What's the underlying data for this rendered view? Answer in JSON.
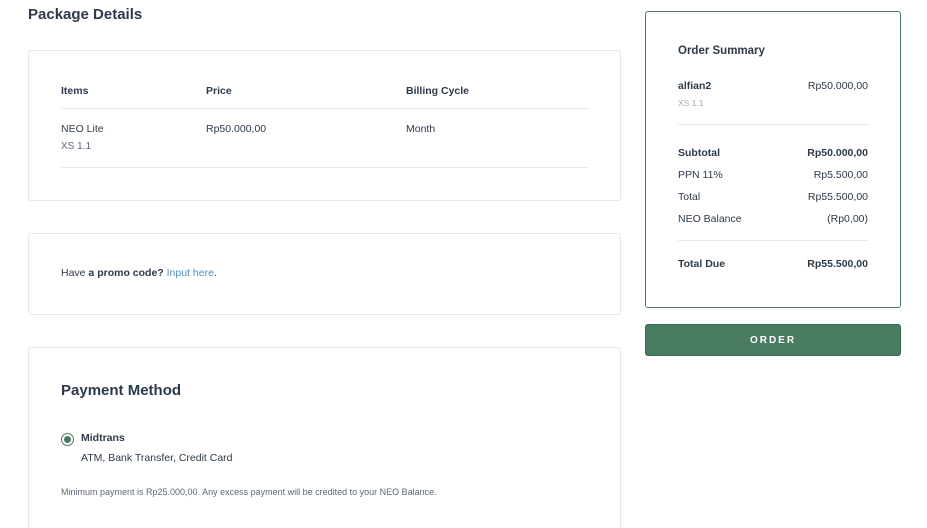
{
  "page_title": "Package Details",
  "package_table": {
    "headers": {
      "items": "Items",
      "price": "Price",
      "billing_cycle": "Billing Cycle"
    },
    "rows": [
      {
        "item": "NEO Lite",
        "variant": "XS 1.1",
        "price": "Rp50.000,00",
        "billing_cycle": "Month"
      }
    ]
  },
  "promo": {
    "prefix": "Have",
    "bold": " a promo code?",
    "link": "Input here",
    "suffix": "."
  },
  "payment": {
    "title": "Payment Method",
    "option_name": "Midtrans",
    "option_desc": "ATM, Bank Transfer, Credit Card",
    "selected": true,
    "note": "Minimum payment is Rp25.000,00. Any excess payment will be credited to your NEO Balance."
  },
  "summary": {
    "title": "Order Summary",
    "item_name": "alfian2",
    "item_variant": "XS 1.1",
    "item_price": "Rp50.000,00",
    "rows": [
      {
        "label": "Subtotal",
        "value": "Rp50.000,00"
      },
      {
        "label": "PPN 11%",
        "value": "Rp5.500,00"
      },
      {
        "label": "Total",
        "value": "Rp55.500,00"
      },
      {
        "label": "NEO Balance",
        "value": "(Rp0,00)"
      }
    ],
    "total_due_label": "Total Due",
    "total_due_value": "Rp55.500,00"
  },
  "order_button": "ORDER",
  "colors": {
    "accent": "#4a7c62",
    "link": "#4a90c9",
    "text": "#2d3a4a",
    "border": "#e6e8eb"
  }
}
